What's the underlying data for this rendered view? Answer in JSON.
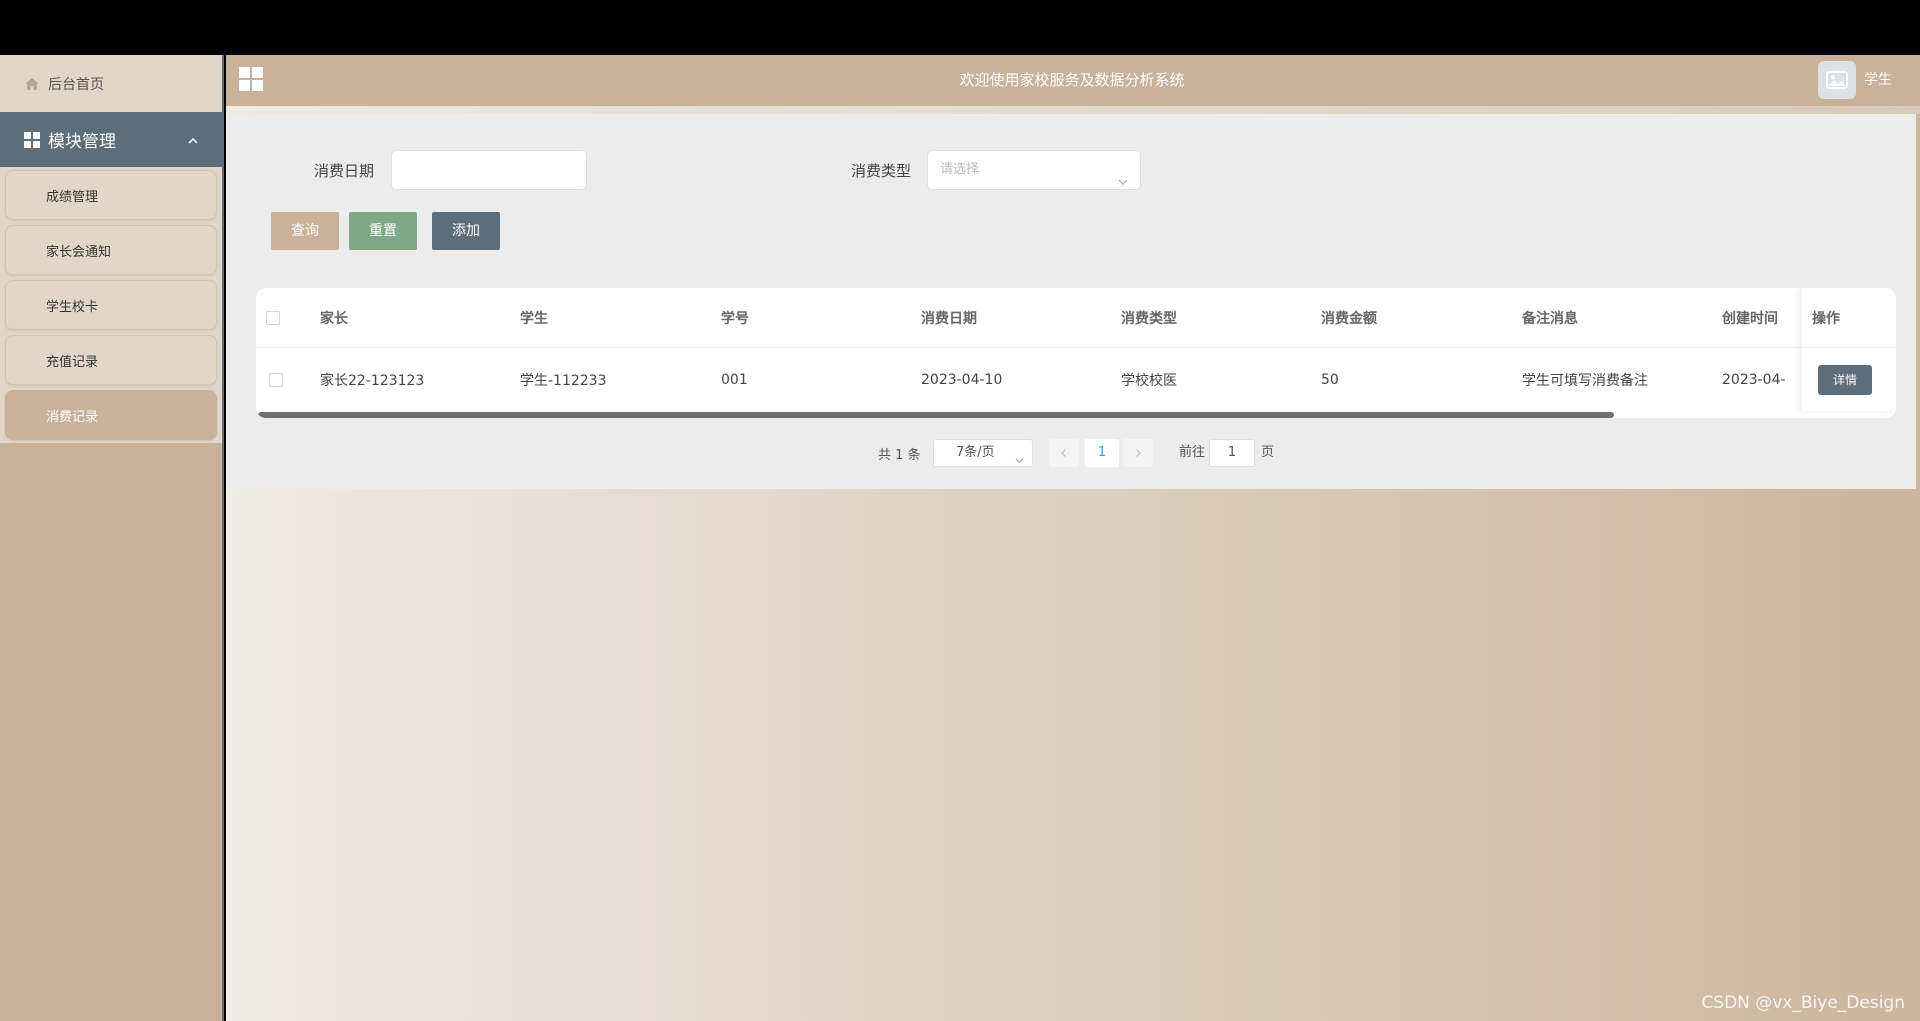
{
  "sidebar": {
    "home_label": "后台首页",
    "group_label": "模块管理",
    "items": [
      {
        "label": "成绩管理"
      },
      {
        "label": "家长会通知"
      },
      {
        "label": "学生校卡"
      },
      {
        "label": "充值记录"
      },
      {
        "label": "消费记录",
        "active": true
      }
    ]
  },
  "header": {
    "title": "欢迎使用家校服务及数据分析系统",
    "user": "学生"
  },
  "filters": {
    "date_label": "消费日期",
    "date_value": "",
    "type_label": "消费类型",
    "type_placeholder": "请选择"
  },
  "buttons": {
    "query": "查询",
    "reset": "重置",
    "add": "添加"
  },
  "table": {
    "columns": [
      "家长",
      "学生",
      "学号",
      "消费日期",
      "消费类型",
      "消费金额",
      "备注消息",
      "创建时间",
      "操作"
    ],
    "rows": [
      {
        "parent": "家长22-123123",
        "student": "学生-112233",
        "student_no": "001",
        "date": "2023-04-10",
        "type": "学校校医",
        "amount": "50",
        "note": "学生可填写消费备注",
        "created": "2023-04-",
        "action": "详情"
      }
    ]
  },
  "pagination": {
    "total": "共 1 条",
    "page_size": "7条/页",
    "current_page": "1",
    "goto_label": "前往",
    "goto_value": "1",
    "unit": "页"
  },
  "watermark": "CSDN @vx_Biye_Design",
  "colors": {
    "accent": "#c8b29a",
    "dark": "#5d6d7a",
    "green": "#7fa886",
    "link": "#409eff"
  }
}
